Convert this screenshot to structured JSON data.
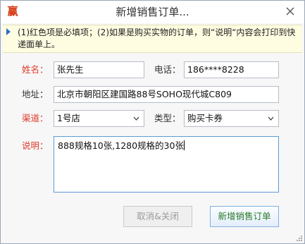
{
  "window": {
    "title": "新增销售订单...",
    "app_icon_glyph": "赢"
  },
  "notice": {
    "text": "(1)红色项是必填项；(2)如果是购买实物的订单，则“说明“内容会打印到快递面单上。"
  },
  "form": {
    "name_label": "姓名：",
    "name_value": "张先生",
    "phone_label": "电话：",
    "phone_value": "186****8228",
    "address_label": "地址：",
    "address_value": "北京市朝阳区建国路88号SOHO现代城C809",
    "channel_label": "渠道：",
    "channel_value": "1号店",
    "type_label": "类型：",
    "type_value": "购买卡券",
    "note_label": "说明：",
    "note_value": "888规格10张,1280规格的30张"
  },
  "buttons": {
    "cancel_label": "取消&关闭",
    "submit_label": "新增销售订单"
  },
  "colors": {
    "required_label": "#e03a2a",
    "notice_bg": "#fffde1",
    "submit_text": "#2a7a2a",
    "accent_border": "#5b9bd5"
  }
}
